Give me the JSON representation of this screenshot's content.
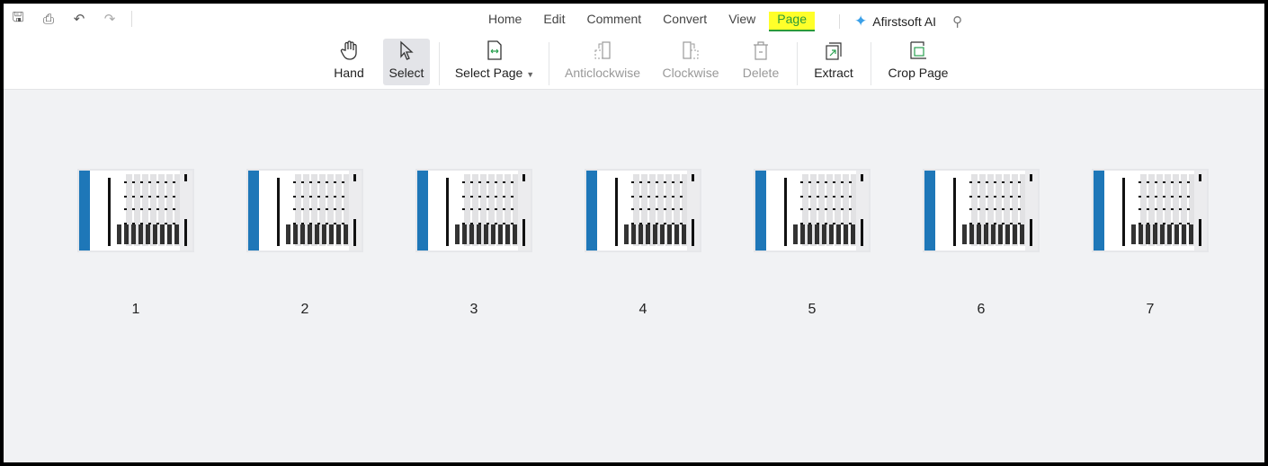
{
  "quick_access": [
    {
      "icon": "save-icon"
    },
    {
      "icon": "print-icon"
    },
    {
      "icon": "undo-icon"
    },
    {
      "icon": "redo-icon"
    }
  ],
  "menu": {
    "items": [
      "Home",
      "Edit",
      "Comment",
      "Convert",
      "View",
      "Page"
    ],
    "active": "Page",
    "ai_label": "Afirstsoft AI"
  },
  "toolbar": {
    "hand": "Hand",
    "select": "Select",
    "select_page": "Select Page",
    "anticlockwise": "Anticlockwise",
    "clockwise": "Clockwise",
    "delete": "Delete",
    "extract": "Extract",
    "crop_page": "Crop Page"
  },
  "pages": [
    "1",
    "2",
    "3",
    "4",
    "5",
    "6",
    "7"
  ],
  "colors": {
    "accent": "#2a9a3a",
    "highlight": "#ffff2a",
    "thumb_strip": "#1e77b8"
  }
}
